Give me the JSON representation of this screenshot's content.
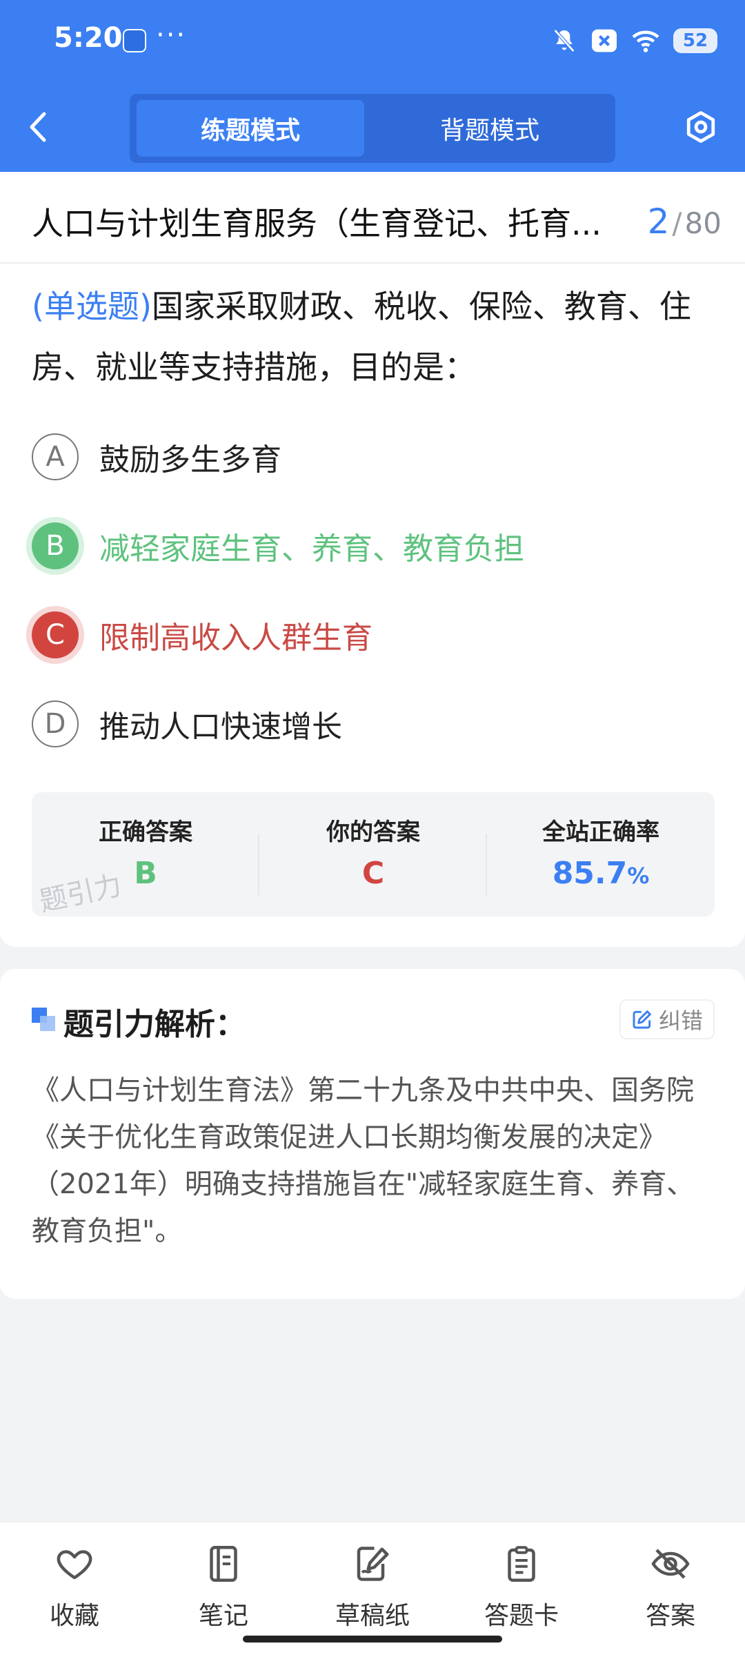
{
  "status_bar": {
    "time": "5:20",
    "dots": "···",
    "battery": "52"
  },
  "header": {
    "tabs": [
      "练题模式",
      "背题模式"
    ],
    "active_tab": 0
  },
  "question": {
    "title": "人口与计划生育服务（生育登记、托育...",
    "current": "2",
    "sep": "/",
    "total": "80",
    "type_label": "(单选题)",
    "stem": "国家采取财政、税收、保险、教育、住房、就业等支持措施，目的是：",
    "options": [
      {
        "letter": "A",
        "text": "鼓励多生多育"
      },
      {
        "letter": "B",
        "text": "减轻家庭生育、养育、教育负担"
      },
      {
        "letter": "C",
        "text": "限制高收入人群生育"
      },
      {
        "letter": "D",
        "text": "推动人口快速增长"
      }
    ]
  },
  "stats": {
    "correct_label": "正确答案",
    "correct_value": "B",
    "yours_label": "你的答案",
    "yours_value": "C",
    "rate_label": "全站正确率",
    "rate_value": "85.7",
    "rate_unit": "%",
    "watermark": "题引力"
  },
  "analysis": {
    "title": "题引力解析：",
    "correct_btn": "纠错",
    "body": "《人口与计划生育法》第二十九条及中共中央、国务院《关于优化生育政策促进人口长期均衡发展的决定》（2021年）明确支持措施旨在\"减轻家庭生育、养育、教育负担\"。"
  },
  "bottom_bar": [
    {
      "label": "收藏",
      "icon": "heart-icon"
    },
    {
      "label": "笔记",
      "icon": "notebook-icon"
    },
    {
      "label": "草稿纸",
      "icon": "draft-paper-icon"
    },
    {
      "label": "答题卡",
      "icon": "answer-card-icon"
    },
    {
      "label": "答案",
      "icon": "eye-off-icon"
    }
  ],
  "colors": {
    "primary": "#3b7ff2",
    "correct": "#5ec27e",
    "wrong": "#d2453f"
  }
}
